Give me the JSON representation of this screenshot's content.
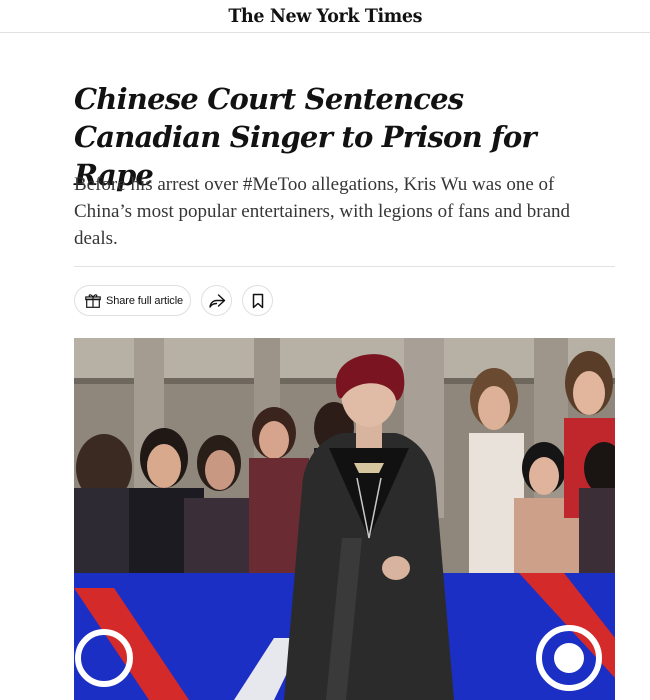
{
  "masthead": {
    "logo_text": "The New York Times"
  },
  "article": {
    "headline": "Chinese Court Sentences Canadian Singer to Prison for Rape",
    "summary": "Before his arrest over #MeToo allegations, Kris Wu was one of China’s most popular entertainers, with legions of fans and brand deals."
  },
  "actions": {
    "share_label": "Share full article",
    "share_icon": "gift-icon",
    "forward_icon": "share-arrow-icon",
    "save_icon": "bookmark-icon"
  },
  "photo": {
    "subject": "singer-on-red-carpet-photo",
    "colors": {
      "hair": "#7a1420",
      "suit": "#2b2b2b",
      "banner_blue": "#1c2fc4",
      "banner_red": "#d52a2a"
    }
  }
}
